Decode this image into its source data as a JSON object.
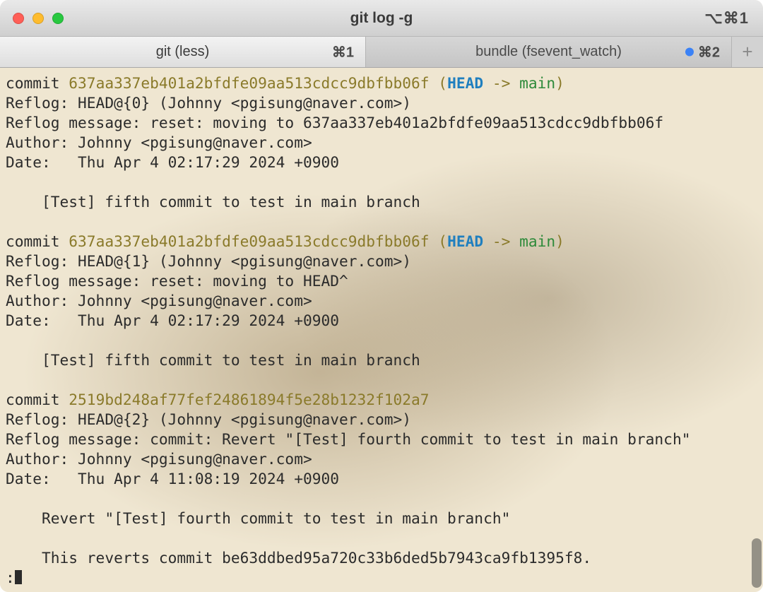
{
  "window": {
    "title": "git log -g",
    "shortcut": "⌥⌘1"
  },
  "tabs": [
    {
      "label": "git (less)",
      "shortcut": "⌘1",
      "active": true,
      "hasDot": false
    },
    {
      "label": "bundle (fsevent_watch)",
      "shortcut": "⌘2",
      "active": false,
      "hasDot": true
    }
  ],
  "newtab": "+",
  "entries": [
    {
      "commit_prefix": "commit ",
      "hash": "637aa337eb401a2bfdfe09aa513cdcc9dbfbb06f",
      "ref_open": " (",
      "ref_head": "HEAD",
      "ref_arrow": " -> ",
      "ref_branch": "main",
      "ref_close": ")",
      "reflog": "Reflog: HEAD@{0} (Johnny <pgisung@naver.com>)",
      "reflog_msg": "Reflog message: reset: moving to 637aa337eb401a2bfdfe09aa513cdcc9dbfbb06f",
      "author": "Author: Johnny <pgisung@naver.com>",
      "date": "Date:   Thu Apr 4 02:17:29 2024 +0900",
      "body1": "    [Test] fifth commit to test in main branch"
    },
    {
      "commit_prefix": "commit ",
      "hash": "637aa337eb401a2bfdfe09aa513cdcc9dbfbb06f",
      "ref_open": " (",
      "ref_head": "HEAD",
      "ref_arrow": " -> ",
      "ref_branch": "main",
      "ref_close": ")",
      "reflog": "Reflog: HEAD@{1} (Johnny <pgisung@naver.com>)",
      "reflog_msg": "Reflog message: reset: moving to HEAD^",
      "author": "Author: Johnny <pgisung@naver.com>",
      "date": "Date:   Thu Apr 4 02:17:29 2024 +0900",
      "body1": "    [Test] fifth commit to test in main branch"
    },
    {
      "commit_prefix": "commit ",
      "hash": "2519bd248af77fef24861894f5e28b1232f102a7",
      "ref_open": "",
      "ref_head": "",
      "ref_arrow": "",
      "ref_branch": "",
      "ref_close": "",
      "reflog": "Reflog: HEAD@{2} (Johnny <pgisung@naver.com>)",
      "reflog_msg": "Reflog message: commit: Revert \"[Test] fourth commit to test in main branch\"",
      "author": "Author: Johnny <pgisung@naver.com>",
      "date": "Date:   Thu Apr 4 11:08:19 2024 +0900",
      "body1": "    Revert \"[Test] fourth commit to test in main branch\"",
      "body2": "    This reverts commit be63ddbed95a720c33b6ded5b7943ca9fb1395f8."
    }
  ],
  "pager_prompt": ":"
}
